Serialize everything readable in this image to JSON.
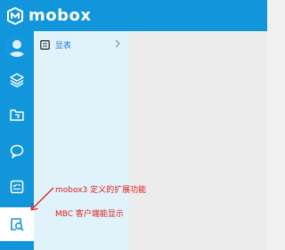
{
  "app": {
    "brand": "mobox"
  },
  "colors": {
    "primary": "#1296db",
    "panel_bg": "#e0f3fb",
    "content_bg": "#ececec",
    "annotation": "#e02020",
    "link": "#2a7ad9"
  },
  "sidebar": {
    "items": [
      {
        "icon": "avatar-icon"
      },
      {
        "icon": "layers-icon"
      },
      {
        "icon": "folder-icon"
      },
      {
        "icon": "chat-bubble-icon"
      },
      {
        "icon": "checklist-icon"
      },
      {
        "icon": "search-document-icon",
        "active": true
      }
    ]
  },
  "panel": {
    "items": [
      {
        "label": "显表",
        "icon": "list-icon"
      }
    ]
  },
  "annotations": {
    "line1": "mobox3 定义的扩展功能",
    "line2": "MBC 客户端能显示"
  }
}
